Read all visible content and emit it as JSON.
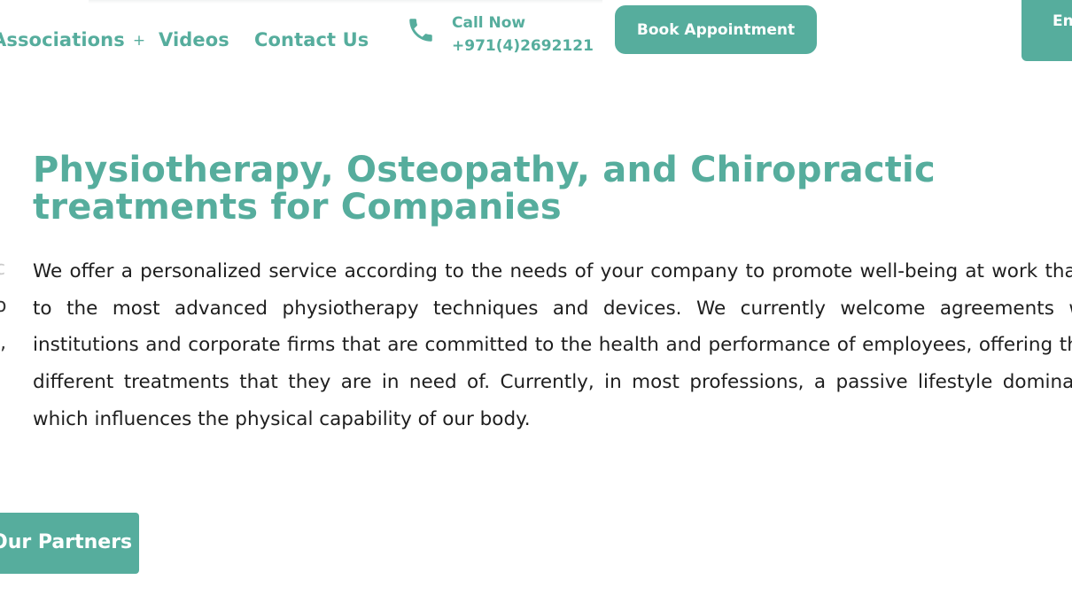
{
  "header": {
    "nav": {
      "associations_label": "Associations",
      "associations_expand": "+",
      "videos_label": "Videos",
      "contact_label": "Contact Us"
    },
    "call": {
      "label": "Call Now",
      "number": "+971(4)2692121"
    },
    "book_label": "Book Appointment",
    "language_label": "En"
  },
  "main": {
    "heading": "Physiotherapy, Osteopathy, and Chiropractic treatments for Companies",
    "body": "We offer a personalized service according to the needs of your company to promote well-being at work thanks to the most advanced physiotherapy techniques and devices. We currently welcome agreements with institutions and corporate firms that are committed to the health and performance of employees, offering them different treatments that they are in need of. Currently, in most professions, a passive lifestyle dominates, which influences the physical capability of our body.",
    "partners_label": "Our Partners"
  },
  "left_fragments": [
    "c",
    "o",
    "l,"
  ],
  "colors": {
    "accent": "#56ad9d",
    "text": "#1e1e1e",
    "background": "#ffffff"
  },
  "icons": {
    "phone": "phone-icon",
    "plus": "plus-icon"
  }
}
